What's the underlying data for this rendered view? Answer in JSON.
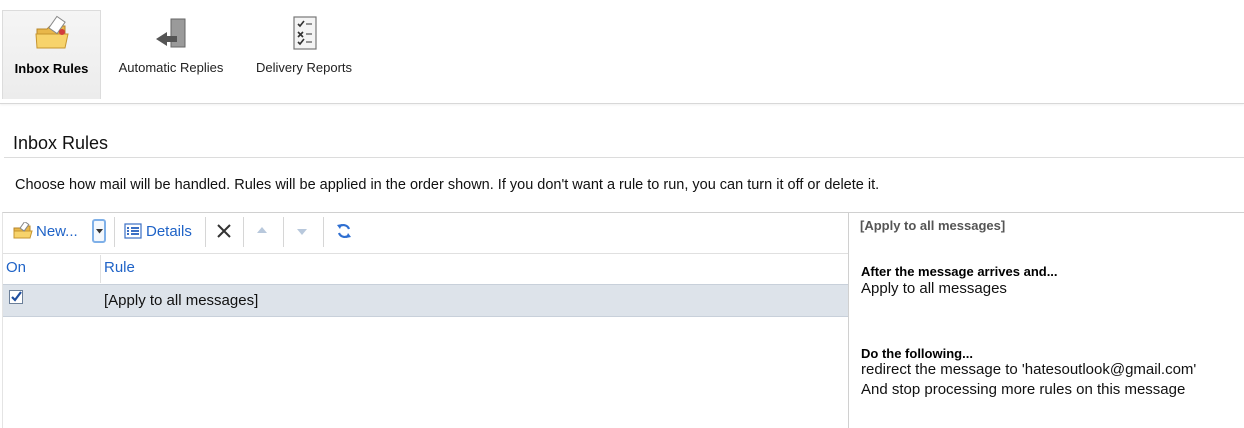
{
  "tabs": [
    {
      "label": "Inbox Rules",
      "icon": "folder-rules-icon",
      "active": true
    },
    {
      "label": "Automatic Replies",
      "icon": "auto-reply-icon",
      "active": false
    },
    {
      "label": "Delivery Reports",
      "icon": "delivery-report-icon",
      "active": false
    }
  ],
  "page": {
    "title": "Inbox Rules",
    "description": "Choose how mail will be handled. Rules will be applied in the order shown. If you don't want a rule to run, you can turn it off or delete it."
  },
  "toolbar": {
    "new_label": "New...",
    "details_label": "Details"
  },
  "table": {
    "columns": [
      "On",
      "Rule"
    ],
    "rows": [
      {
        "on": true,
        "rule": "[Apply to all messages]"
      }
    ]
  },
  "detail": {
    "title": "[Apply to all messages]",
    "condition_head": "After the message arrives and...",
    "condition": "Apply to all messages",
    "action_head": "Do the following...",
    "action_1": "redirect the message to 'hatesoutlook@gmail.com'",
    "action_2": "And stop processing more rules on this message"
  },
  "colors": {
    "link_blue": "#1f63c7",
    "selected_row": "#dde3ea"
  }
}
